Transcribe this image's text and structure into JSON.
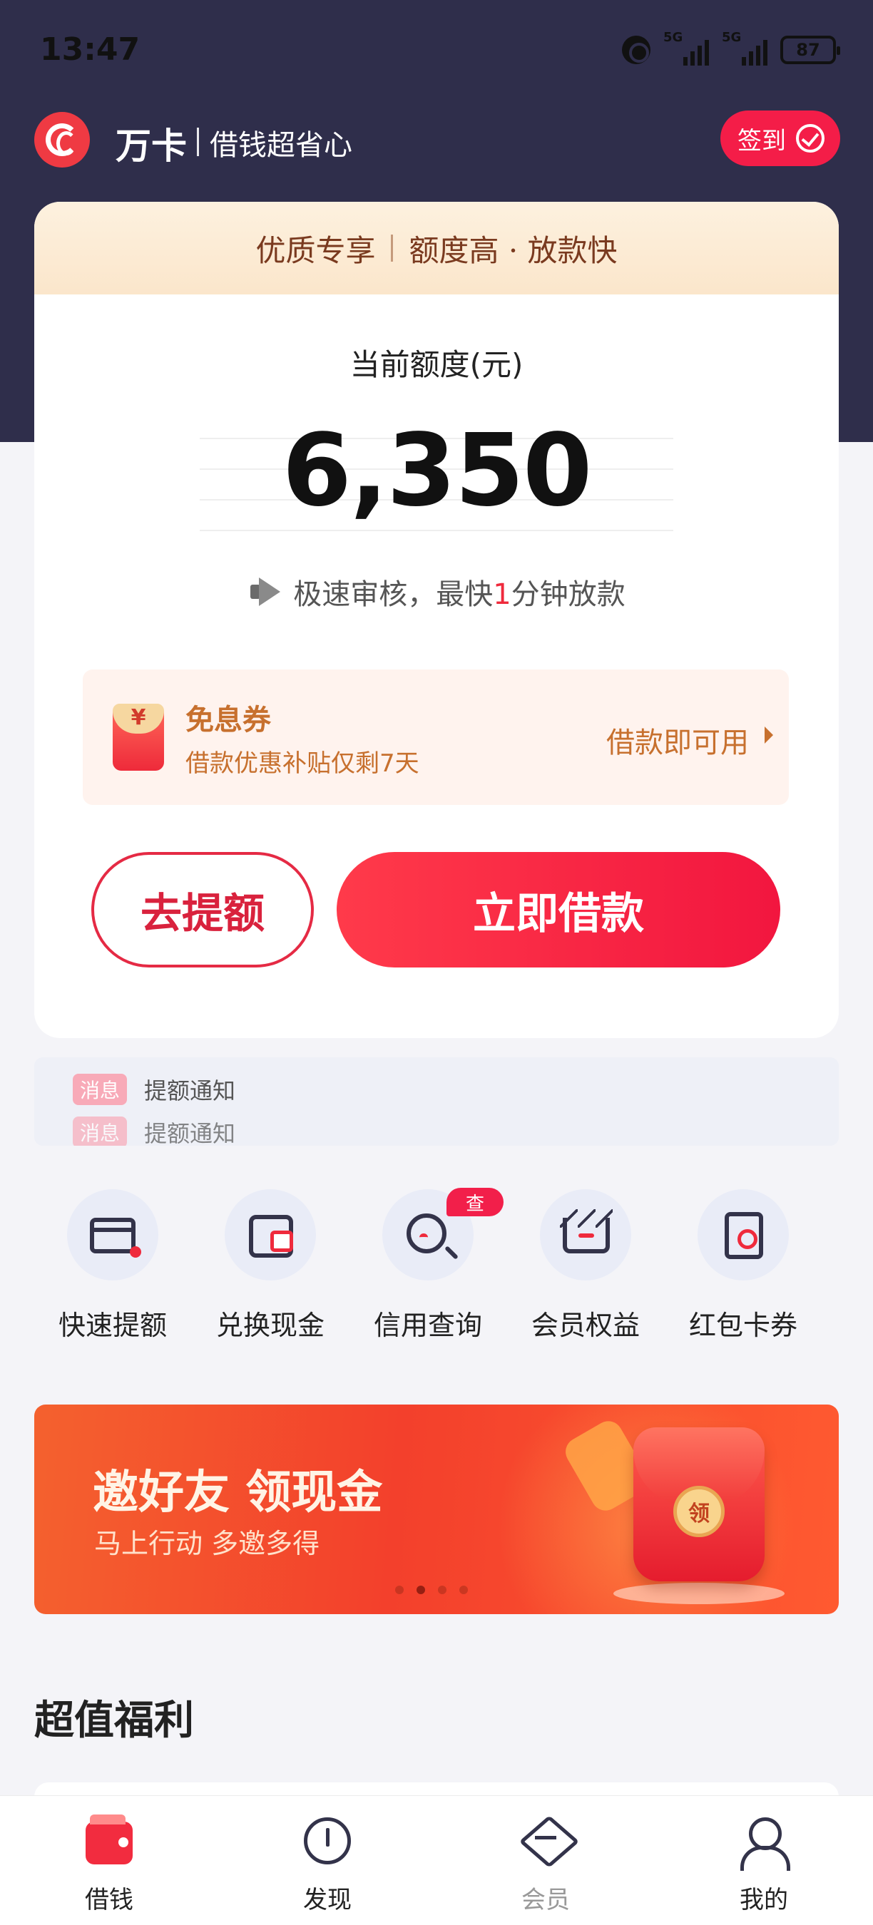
{
  "status_bar": {
    "time": "13:47",
    "signal1_label": "5G",
    "signal2_label": "5G",
    "battery": "87"
  },
  "header": {
    "brand": "万卡",
    "slogan": "借钱超省心",
    "signin_label": "签到"
  },
  "card": {
    "banner_left": "优质专享",
    "banner_right": "额度高 · 放款快",
    "quota_label": "当前额度(元)",
    "quota_value": "6,350",
    "notice_prefix": "极速审核，最快",
    "notice_highlight": "1",
    "notice_suffix": "分钟放款",
    "coupon": {
      "title": "免息券",
      "subtitle": "借款优惠补贴仅剩7天",
      "action": "借款即可用"
    },
    "raise_button": "去提额",
    "borrow_button": "立即借款"
  },
  "ticker": {
    "items": [
      {
        "tag": "消息",
        "text": "提额通知"
      },
      {
        "tag": "消息",
        "text": "提额通知"
      }
    ]
  },
  "quick_actions": [
    {
      "label": "快速提额",
      "icon": "card-up-icon"
    },
    {
      "label": "兑换现金",
      "icon": "wallet-icon"
    },
    {
      "label": "信用查询",
      "icon": "search-icon",
      "badge": "查"
    },
    {
      "label": "会员权益",
      "icon": "crown-icon"
    },
    {
      "label": "红包卡券",
      "icon": "red-packet-icon"
    }
  ],
  "promo": {
    "title": "邀好友 领现金",
    "subtitle": "马上行动 多邀多得",
    "seal_text": "领",
    "dots_total": 4,
    "dots_active": 1
  },
  "section": {
    "title": "超值福利"
  },
  "tabbar": {
    "tabs": [
      {
        "label": "借钱",
        "icon": "wallet-icon",
        "active": true
      },
      {
        "label": "发现",
        "icon": "compass-icon",
        "active": false
      },
      {
        "label": "会员",
        "icon": "diamond-icon",
        "active": false
      },
      {
        "label": "我的",
        "icon": "user-icon",
        "active": false
      }
    ]
  },
  "colors": {
    "header_bg": "#2f2e4b",
    "accent_red": "#f22c3f",
    "coupon_text": "#c7702e"
  }
}
